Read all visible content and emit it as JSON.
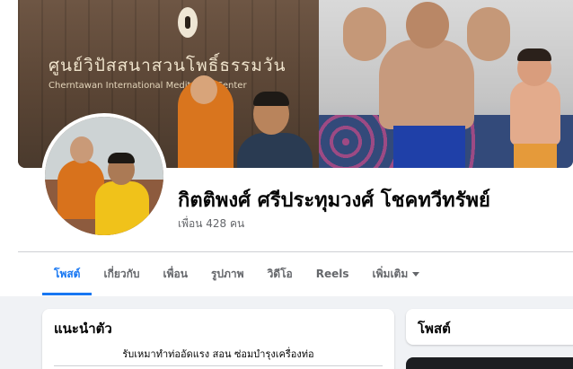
{
  "cover": {
    "sign_thai": "ศูนย์วิปัสสนาสวนโพธิ์ธรรมวัน",
    "sign_english": "Cherntawan International Meditation Center"
  },
  "profile": {
    "name": "กิตติพงศ์ ศรีประทุมวงศ์ โชคทวีทรัพย์",
    "friends_label": "เพื่อน 428 คน"
  },
  "tabs": [
    {
      "label": "โพสต์",
      "active": true
    },
    {
      "label": "เกี่ยวกับ",
      "active": false
    },
    {
      "label": "เพื่อน",
      "active": false
    },
    {
      "label": "รูปภาพ",
      "active": false
    },
    {
      "label": "วิดีโอ",
      "active": false
    },
    {
      "label": "Reels",
      "active": false
    },
    {
      "label": "เพิ่มเติม",
      "active": false
    }
  ],
  "intro": {
    "title": "แนะนำตัว",
    "bio": "รับเหมาทำท่ออัดแรง สอน ซ่อมบำรุงเครื่องท่อ"
  },
  "posts": {
    "title": "โพสต์"
  },
  "colors": {
    "accent": "#1877f2",
    "background": "#f0f2f5",
    "text_secondary": "#65676b"
  }
}
